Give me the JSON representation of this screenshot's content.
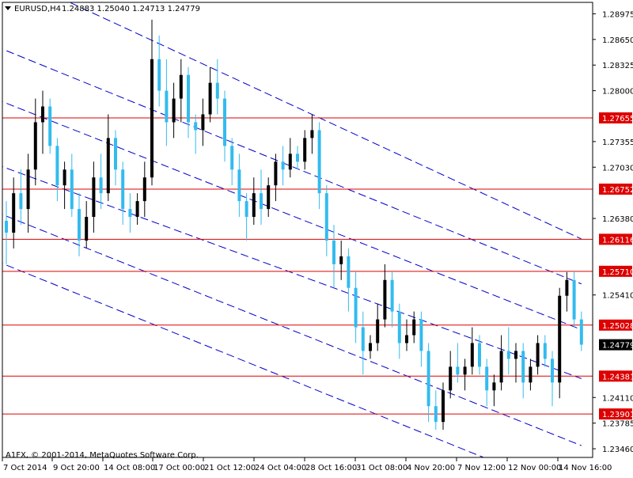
{
  "header": {
    "symbol": "EURUSD,H4",
    "ohlc": "1.24883 1.25040 1.24713 1.24779"
  },
  "copyright": "A1FX, © 2001-2014, MetaQuotes Software Corp.",
  "colors": {
    "bull": "#000000",
    "bear": "#33bbee",
    "hline": "#dd0000",
    "channel": "#0000cc",
    "text": "#000000"
  },
  "chart_data": {
    "type": "candlestick",
    "title": "",
    "x_tick_labels": [
      "7 Oct 2014",
      "9 Oct 20:00",
      "14 Oct 08:00",
      "17 Oct 00:00",
      "21 Oct 12:00",
      "24 Oct 04:00",
      "28 Oct 16:00",
      "31 Oct 08:00",
      "4 Nov 20:00",
      "7 Nov 12:00",
      "12 Nov 00:00",
      "14 Nov 16:00"
    ],
    "y_tick_labels": [
      "1.28975",
      "1.28650",
      "1.28325",
      "1.28000",
      "1.27355",
      "1.27030",
      "1.26380",
      "1.25410",
      "1.24110",
      "1.23785",
      "1.23460"
    ],
    "ylim": [
      1.2335,
      1.2912
    ],
    "horizontal_lines": [
      {
        "value": 1.27655,
        "label": "1.27655"
      },
      {
        "value": 1.26752,
        "label": "1.26752"
      },
      {
        "value": 1.26116,
        "label": "1.26116"
      },
      {
        "value": 1.2571,
        "label": "1.25710"
      },
      {
        "value": 1.25028,
        "label": "1.25028"
      },
      {
        "value": 1.24381,
        "label": "1.24381"
      },
      {
        "value": 1.23901,
        "label": "1.23901"
      }
    ],
    "current_price": {
      "value": 1.24779,
      "label": "1.24779"
    },
    "candles": [
      [
        1.2635,
        1.266,
        1.258,
        1.262
      ],
      [
        1.262,
        1.269,
        1.26,
        1.267
      ],
      [
        1.267,
        1.27,
        1.263,
        1.265
      ],
      [
        1.265,
        1.272,
        1.262,
        1.27
      ],
      [
        1.27,
        1.279,
        1.268,
        1.276
      ],
      [
        1.276,
        1.28,
        1.272,
        1.278
      ],
      [
        1.278,
        1.279,
        1.272,
        1.273
      ],
      [
        1.273,
        1.274,
        1.266,
        1.268
      ],
      [
        1.268,
        1.271,
        1.265,
        1.27
      ],
      [
        1.27,
        1.272,
        1.264,
        1.265
      ],
      [
        1.265,
        1.267,
        1.259,
        1.261
      ],
      [
        1.261,
        1.266,
        1.26,
        1.264
      ],
      [
        1.264,
        1.271,
        1.262,
        1.269
      ],
      [
        1.269,
        1.272,
        1.265,
        1.267
      ],
      [
        1.267,
        1.277,
        1.266,
        1.274
      ],
      [
        1.274,
        1.275,
        1.268,
        1.27
      ],
      [
        1.27,
        1.271,
        1.263,
        1.265
      ],
      [
        1.265,
        1.267,
        1.262,
        1.264
      ],
      [
        1.264,
        1.267,
        1.263,
        1.266
      ],
      [
        1.266,
        1.271,
        1.264,
        1.269
      ],
      [
        1.269,
        1.289,
        1.268,
        1.284
      ],
      [
        1.284,
        1.287,
        1.278,
        1.28
      ],
      [
        1.28,
        1.284,
        1.273,
        1.276
      ],
      [
        1.276,
        1.281,
        1.274,
        1.279
      ],
      [
        1.279,
        1.284,
        1.276,
        1.282
      ],
      [
        1.282,
        1.283,
        1.274,
        1.276
      ],
      [
        1.276,
        1.277,
        1.272,
        1.275
      ],
      [
        1.275,
        1.279,
        1.273,
        1.277
      ],
      [
        1.277,
        1.283,
        1.276,
        1.281
      ],
      [
        1.281,
        1.284,
        1.277,
        1.279
      ],
      [
        1.279,
        1.28,
        1.271,
        1.273
      ],
      [
        1.273,
        1.274,
        1.268,
        1.27
      ],
      [
        1.27,
        1.272,
        1.264,
        1.266
      ],
      [
        1.266,
        1.267,
        1.261,
        1.264
      ],
      [
        1.264,
        1.269,
        1.263,
        1.267
      ],
      [
        1.267,
        1.27,
        1.263,
        1.265
      ],
      [
        1.265,
        1.269,
        1.264,
        1.268
      ],
      [
        1.268,
        1.272,
        1.266,
        1.271
      ],
      [
        1.271,
        1.273,
        1.268,
        1.27
      ],
      [
        1.27,
        1.274,
        1.269,
        1.272
      ],
      [
        1.272,
        1.273,
        1.27,
        1.271
      ],
      [
        1.271,
        1.275,
        1.27,
        1.274
      ],
      [
        1.274,
        1.277,
        1.272,
        1.275
      ],
      [
        1.275,
        1.276,
        1.265,
        1.267
      ],
      [
        1.267,
        1.268,
        1.259,
        1.261
      ],
      [
        1.261,
        1.263,
        1.255,
        1.258
      ],
      [
        1.258,
        1.261,
        1.256,
        1.259
      ],
      [
        1.259,
        1.26,
        1.252,
        1.255
      ],
      [
        1.255,
        1.257,
        1.248,
        1.25
      ],
      [
        1.25,
        1.252,
        1.244,
        1.247
      ],
      [
        1.247,
        1.249,
        1.246,
        1.248
      ],
      [
        1.248,
        1.253,
        1.247,
        1.251
      ],
      [
        1.251,
        1.258,
        1.25,
        1.256
      ],
      [
        1.256,
        1.257,
        1.25,
        1.252
      ],
      [
        1.252,
        1.253,
        1.246,
        1.248
      ],
      [
        1.248,
        1.251,
        1.247,
        1.249
      ],
      [
        1.249,
        1.252,
        1.248,
        1.251
      ],
      [
        1.251,
        1.252,
        1.245,
        1.247
      ],
      [
        1.247,
        1.248,
        1.238,
        1.24
      ],
      [
        1.24,
        1.242,
        1.237,
        1.238
      ],
      [
        1.238,
        1.243,
        1.237,
        1.242
      ],
      [
        1.242,
        1.247,
        1.241,
        1.245
      ],
      [
        1.245,
        1.248,
        1.243,
        1.244
      ],
      [
        1.244,
        1.246,
        1.242,
        1.245
      ],
      [
        1.245,
        1.25,
        1.244,
        1.248
      ],
      [
        1.248,
        1.249,
        1.244,
        1.245
      ],
      [
        1.245,
        1.246,
        1.24,
        1.242
      ],
      [
        1.242,
        1.244,
        1.24,
        1.243
      ],
      [
        1.243,
        1.249,
        1.242,
        1.247
      ],
      [
        1.247,
        1.25,
        1.244,
        1.246
      ],
      [
        1.246,
        1.248,
        1.243,
        1.247
      ],
      [
        1.247,
        1.248,
        1.241,
        1.243
      ],
      [
        1.243,
        1.246,
        1.242,
        1.245
      ],
      [
        1.245,
        1.249,
        1.244,
        1.248
      ],
      [
        1.248,
        1.249,
        1.245,
        1.246
      ],
      [
        1.246,
        1.247,
        1.24,
        1.243
      ],
      [
        1.243,
        1.255,
        1.241,
        1.254
      ],
      [
        1.254,
        1.257,
        1.252,
        1.256
      ],
      [
        1.256,
        1.257,
        1.25,
        1.251
      ],
      [
        1.251,
        1.252,
        1.247,
        1.2478
      ]
    ],
    "channel_lines": [
      {
        "t0": -3,
        "p0": 1.2962,
        "t1": 79,
        "p1": 1.2612
      },
      {
        "t0": -3,
        "p0": 1.2862,
        "t1": 79,
        "p1": 1.2555
      },
      {
        "t0": -3,
        "p0": 1.2795,
        "t1": 79,
        "p1": 1.2497
      },
      {
        "t0": -3,
        "p0": 1.2712,
        "t1": 79,
        "p1": 1.2435
      },
      {
        "t0": -3,
        "p0": 1.2652,
        "t1": 79,
        "p1": 1.235
      },
      {
        "t0": -3,
        "p0": 1.259,
        "t1": 79,
        "p1": 1.2285
      }
    ]
  }
}
